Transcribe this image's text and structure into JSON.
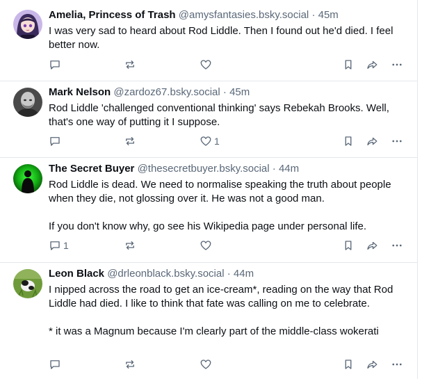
{
  "posts": [
    {
      "name": "Amelia, Princess of Trash",
      "handle": "@amysfantasies.bsky.social",
      "separator": "·",
      "time": "45m",
      "paragraphs": [
        "I was very sad to heard about Rod Liddle. Then I found out he'd died. I feel better now."
      ],
      "reply_count": "",
      "like_count": "",
      "avatar": "anime-girl-avatar"
    },
    {
      "name": "Mark Nelson",
      "handle": "@zardoz67.bsky.social",
      "separator": "·",
      "time": "45m",
      "paragraphs": [
        "Rod Liddle 'challenged conventional thinking' says Rebekah Brooks. Well, that's one way of putting it I suppose."
      ],
      "reply_count": "",
      "like_count": "1",
      "avatar": "bald-man-photo-avatar"
    },
    {
      "name": "The Secret Buyer",
      "handle": "@thesecretbuyer.bsky.social",
      "separator": "·",
      "time": "44m",
      "paragraphs": [
        "Rod Liddle is dead. We need to normalise speaking the truth about people when they die, not glossing over it. He was not a good man.",
        "If you don't know why, go see his Wikipedia page under personal life."
      ],
      "reply_count": "1",
      "like_count": "",
      "avatar": "green-silhouette-avatar"
    },
    {
      "name": "Leon Black",
      "handle": "@drleonblack.bsky.social",
      "separator": "·",
      "time": "44m",
      "paragraphs": [
        "I nipped across the road to get an ice-cream*, reading on the way that Rod Liddle had died. I like to think that fate was calling on me to celebrate.",
        "* it was a Magnum because I'm clearly part of the middle-class wokerati"
      ],
      "reply_count": "",
      "like_count": "",
      "avatar": "dog-in-grass-avatar"
    }
  ],
  "icons": {
    "reply": "reply-icon",
    "repost": "repost-icon",
    "like": "heart-icon",
    "bookmark": "bookmark-icon",
    "share": "share-icon",
    "more": "more-options-icon"
  },
  "colors": {
    "name": "#0b0f14",
    "meta": "#5a6878",
    "divider": "#e4e8ec"
  }
}
